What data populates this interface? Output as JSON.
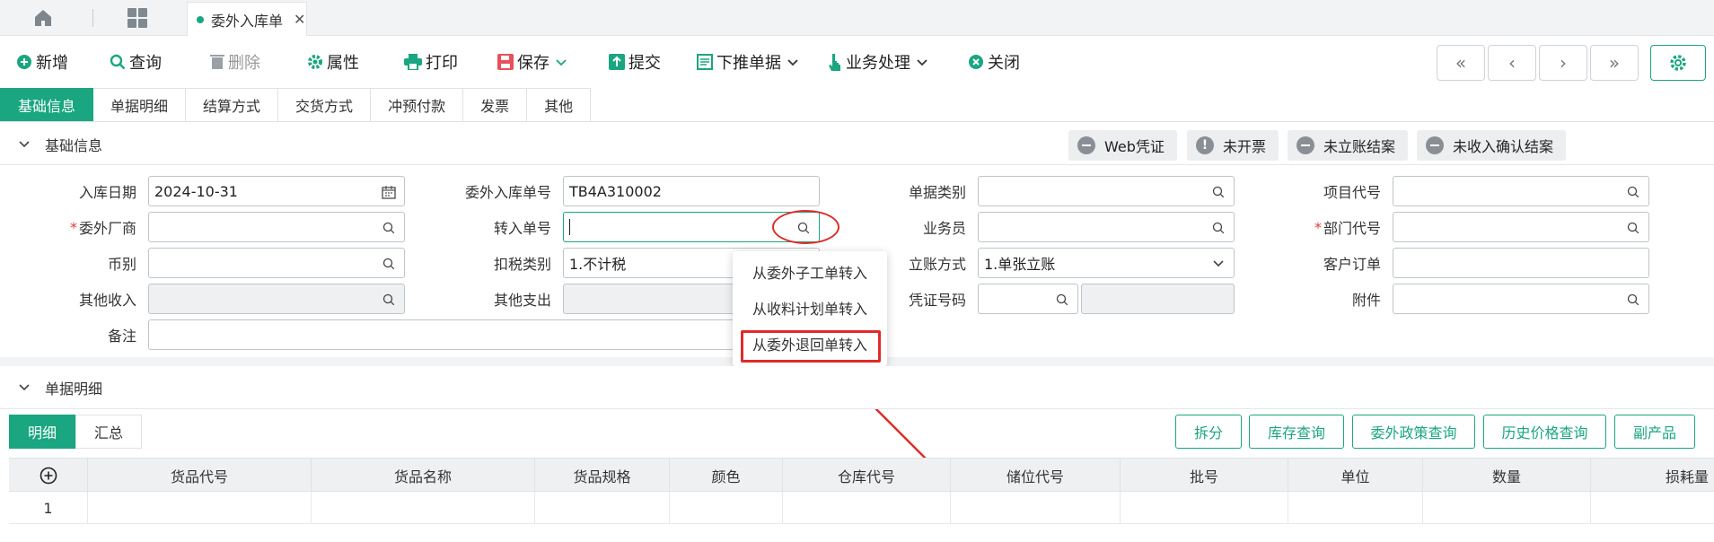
{
  "tabs": {
    "active_doc": "委外入库单"
  },
  "toolbar": {
    "add": "新增",
    "query": "查询",
    "delete": "删除",
    "property": "属性",
    "print": "打印",
    "save": "保存",
    "submit": "提交",
    "push_down": "下推单据",
    "business": "业务处理",
    "close": "关闭"
  },
  "section_tabs": [
    "基础信息",
    "单据明细",
    "结算方式",
    "交货方式",
    "冲预付款",
    "发票",
    "其他"
  ],
  "basic": {
    "title": "基础信息",
    "flags": [
      "Web凭证",
      "未开票",
      "未立账结案",
      "未收入确认结案"
    ]
  },
  "form": {
    "inbound_date_label": "入库日期",
    "inbound_date_value": "2024-10-31",
    "order_no_label": "委外入库单号",
    "order_no_value": "TB4A310002",
    "doc_type_label": "单据类别",
    "project_label": "项目代号",
    "vendor_label": "委外厂商",
    "transfer_label": "转入单号",
    "clerk_label": "业务员",
    "dept_label": "部门代号",
    "currency_label": "币别",
    "tax_label": "扣税类别",
    "tax_value": "1.不计税",
    "account_label": "立账方式",
    "account_value": "1.单张立账",
    "customer_order_label": "客户订单",
    "other_income_label": "其他收入",
    "other_expense_label": "其他支出",
    "voucher_label": "凭证号码",
    "attachment_label": "附件",
    "remark_label": "备注"
  },
  "popup": {
    "items": [
      "从委外子工单转入",
      "从收料计划单转入",
      "从委外退回单转入"
    ]
  },
  "detail": {
    "title": "单据明细",
    "tabs": [
      "明细",
      "汇总"
    ],
    "buttons": [
      "拆分",
      "库存查询",
      "委外政策查询",
      "历史价格查询",
      "副产品"
    ],
    "columns": [
      "货品代号",
      "货品名称",
      "货品规格",
      "颜色",
      "仓库代号",
      "储位代号",
      "批号",
      "单位",
      "数量",
      "损耗量"
    ],
    "row_number": "1"
  },
  "colors": {
    "accent": "#1aa680",
    "annotation": "#e02a2a"
  }
}
